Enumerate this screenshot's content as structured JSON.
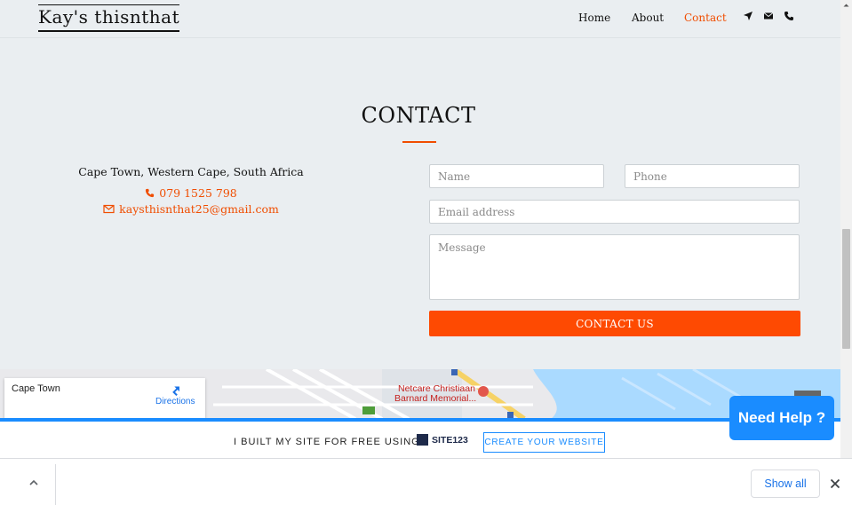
{
  "header": {
    "logo": "Kay's thisnthat",
    "nav": [
      {
        "label": "Home"
      },
      {
        "label": "About"
      },
      {
        "label": "Contact",
        "active": true
      }
    ],
    "icons": [
      "location-arrow-icon",
      "envelope-icon",
      "phone-icon"
    ]
  },
  "contact": {
    "title": "CONTACT",
    "address": "Cape Town, Western Cape, South Africa",
    "phone": "079 1525 798",
    "email": "kaysthisnthat25@gmail.com",
    "form": {
      "name_placeholder": "Name",
      "phone_placeholder": "Phone",
      "email_placeholder": "Email address",
      "message_placeholder": "Message",
      "submit_label": "CONTACT US"
    }
  },
  "map": {
    "place": "Cape Town",
    "directions_label": "Directions",
    "poi_label_line1": "Netcare Christiaan",
    "poi_label_line2": "Barnard Memorial..."
  },
  "need_help": {
    "label": "Need Help ?"
  },
  "promo": {
    "text": "I BUILT MY SITE FOR FREE USING",
    "brand": "SITE123",
    "button": "CREATE YOUR WEBSITE"
  },
  "download_bar": {
    "show_all": "Show all"
  },
  "colors": {
    "accent": "#f04d00",
    "button": "#fe4a02",
    "help_blue": "#1a8cff",
    "background": "#eaeef1"
  }
}
